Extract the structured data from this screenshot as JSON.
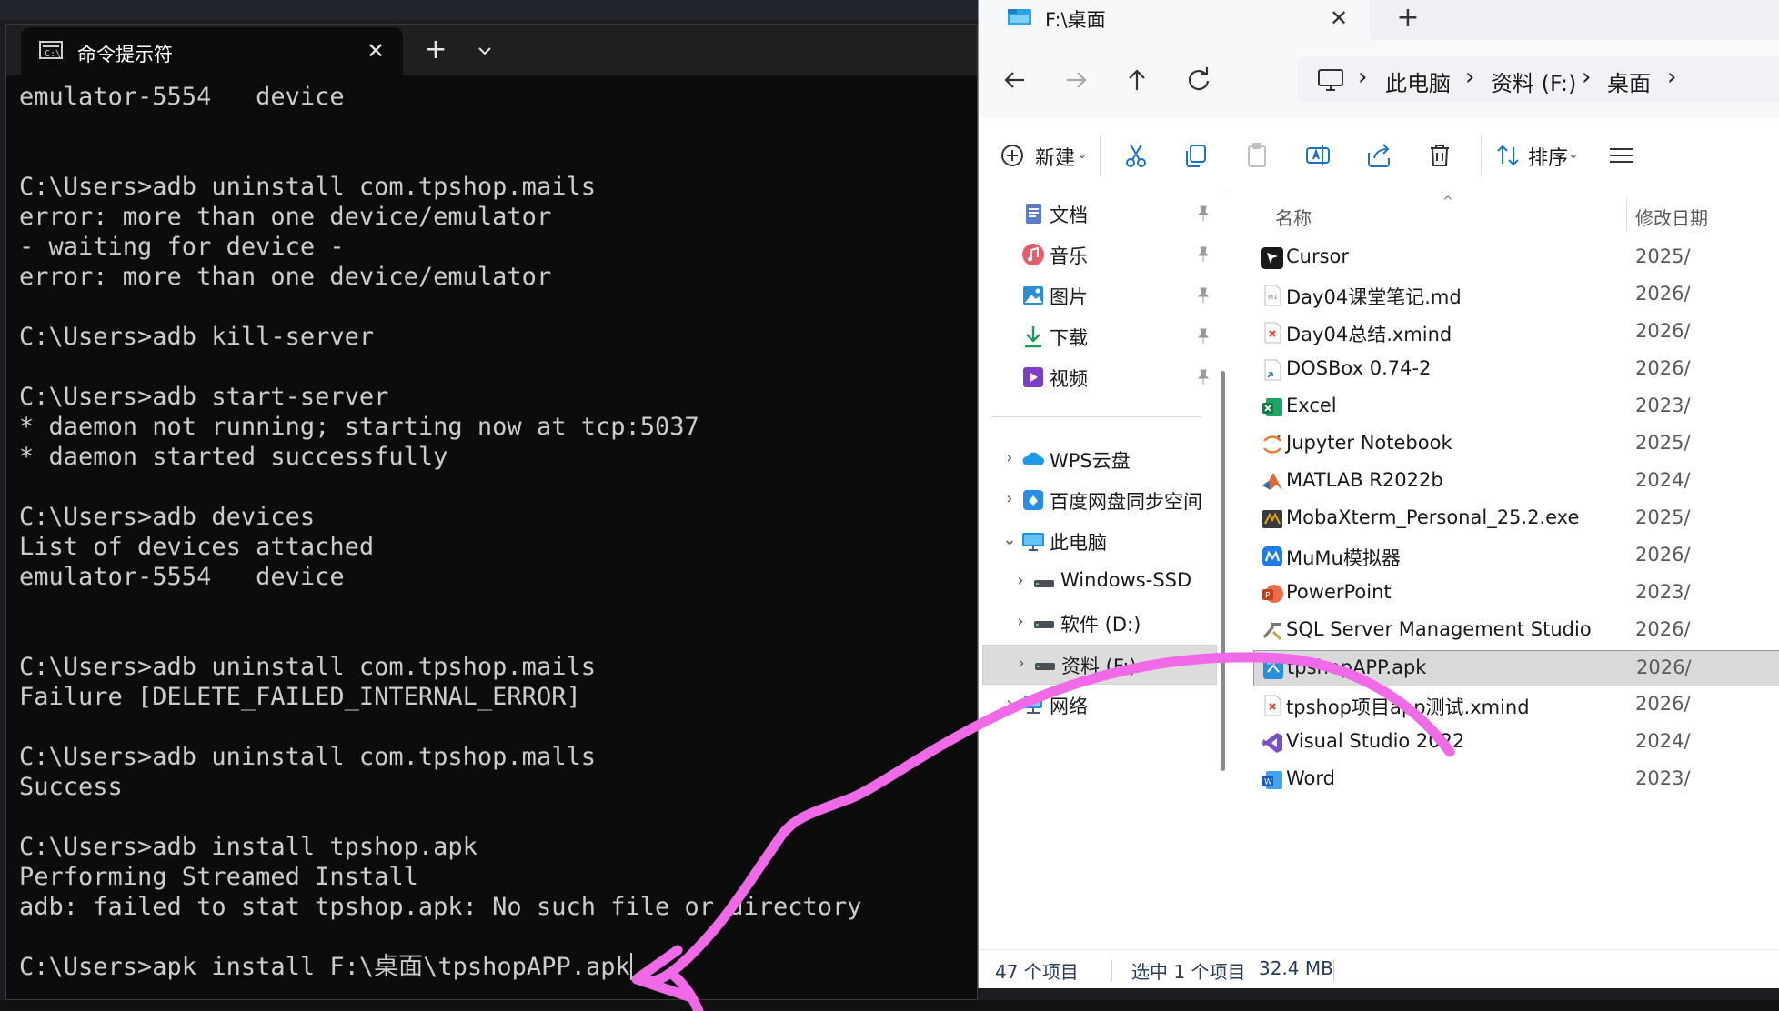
{
  "cmd": {
    "tab_title": "命令提示符",
    "lines": [
      "emulator-5554   device",
      "",
      "",
      "C:\\Users>adb uninstall com.tpshop.mails",
      "error: more than one device/emulator",
      "- waiting for device -",
      "error: more than one device/emulator",
      "",
      "C:\\Users>adb kill-server",
      "",
      "C:\\Users>adb start-server",
      "* daemon not running; starting now at tcp:5037",
      "* daemon started successfully",
      "",
      "C:\\Users>adb devices",
      "List of devices attached",
      "emulator-5554   device",
      "",
      "",
      "C:\\Users>adb uninstall com.tpshop.mails",
      "Failure [DELETE_FAILED_INTERNAL_ERROR]",
      "",
      "C:\\Users>adb uninstall com.tpshop.malls",
      "Success",
      "",
      "C:\\Users>adb install tpshop.apk",
      "Performing Streamed Install",
      "adb: failed to stat tpshop.apk: No such file or directory",
      "",
      "C:\\Users>apk install F:\\桌面\\tpshopAPP.apk"
    ]
  },
  "explorer": {
    "tab_title": "F:\\桌面",
    "breadcrumb": [
      "此电脑",
      "资料 (F:)",
      "桌面"
    ],
    "toolbar": {
      "new_label": "新建",
      "sort_label": "排序"
    },
    "nav_pane": {
      "quick_access": [
        {
          "label": "文档",
          "icon": "document-icon"
        },
        {
          "label": "音乐",
          "icon": "music-icon"
        },
        {
          "label": "图片",
          "icon": "pictures-icon"
        },
        {
          "label": "下载",
          "icon": "download-icon"
        },
        {
          "label": "视频",
          "icon": "video-icon"
        }
      ],
      "tree": [
        {
          "label": "WPS云盘",
          "icon": "cloud-icon"
        },
        {
          "label": "百度网盘同步空间",
          "icon": "baidu-icon"
        },
        {
          "label": "此电脑",
          "icon": "computer-icon"
        },
        {
          "label": "Windows-SSD",
          "icon": "drive-icon"
        },
        {
          "label": "软件 (D:)",
          "icon": "drive-icon"
        },
        {
          "label": "资料 (F:)",
          "icon": "drive-icon"
        },
        {
          "label": "网络",
          "icon": "network-icon"
        }
      ]
    },
    "columns": {
      "name": "名称",
      "modified": "修改日期"
    },
    "files": [
      {
        "name": "Cursor",
        "date": "2025/",
        "icon": "cursor-app-icon"
      },
      {
        "name": "Day04课堂笔记.md",
        "date": "2026/",
        "icon": "markdown-file-icon"
      },
      {
        "name": "Day04总结.xmind",
        "date": "2026/",
        "icon": "xmind-file-icon"
      },
      {
        "name": "DOSBox 0.74-2",
        "date": "2026/",
        "icon": "shortcut-icon"
      },
      {
        "name": "Excel",
        "date": "2023/",
        "icon": "excel-icon"
      },
      {
        "name": "Jupyter Notebook",
        "date": "2025/",
        "icon": "jupyter-icon"
      },
      {
        "name": "MATLAB R2022b",
        "date": "2024/",
        "icon": "matlab-icon"
      },
      {
        "name": "MobaXterm_Personal_25.2.exe",
        "date": "2025/",
        "icon": "mobaxterm-icon"
      },
      {
        "name": "MuMu模拟器",
        "date": "2026/",
        "icon": "mumu-icon"
      },
      {
        "name": "PowerPoint",
        "date": "2023/",
        "icon": "powerpoint-icon"
      },
      {
        "name": "SQL Server Management Studio",
        "date": "2026/",
        "icon": "ssms-icon"
      },
      {
        "name": "tpshopAPP.apk",
        "date": "2026/",
        "icon": "apk-file-icon"
      },
      {
        "name": "tpshop项目app测试.xmind",
        "date": "2026/",
        "icon": "xmind-file-icon"
      },
      {
        "name": "Visual Studio 2022",
        "date": "2024/",
        "icon": "visual-studio-icon"
      },
      {
        "name": "Word",
        "date": "2023/",
        "icon": "word-icon"
      }
    ],
    "selected_file": "tpshopAPP.apk",
    "status": {
      "count": "47 个项目",
      "selection": "选中 1 个项目",
      "size": "32.4 MB"
    }
  },
  "colors": {
    "annotation": "#f06ae8",
    "cmd_bg": "#0c0c0c",
    "cmd_text": "#cccccc",
    "explorer_bg": "#ffffff",
    "selection": "#d9d9d9"
  }
}
